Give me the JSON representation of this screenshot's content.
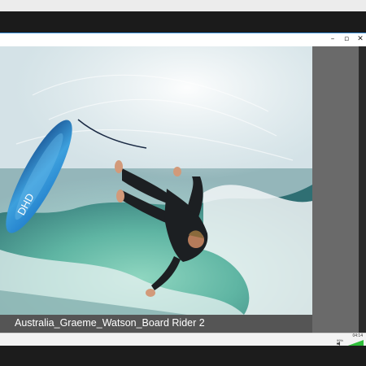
{
  "window": {
    "minimize_icon": "minimize-icon",
    "maximize_icon": "maximize-icon",
    "close_icon": "close-icon",
    "minimize_glyph": "–",
    "maximize_glyph": "▫",
    "close_glyph": "✕"
  },
  "slide": {
    "caption": "Australia_Graeme_Watson_Board Rider 2"
  },
  "tray": {
    "time": "04:14",
    "battery": "99%"
  },
  "colors": {
    "accent": "#3a8fd8",
    "signal": "#2fbf3a"
  }
}
